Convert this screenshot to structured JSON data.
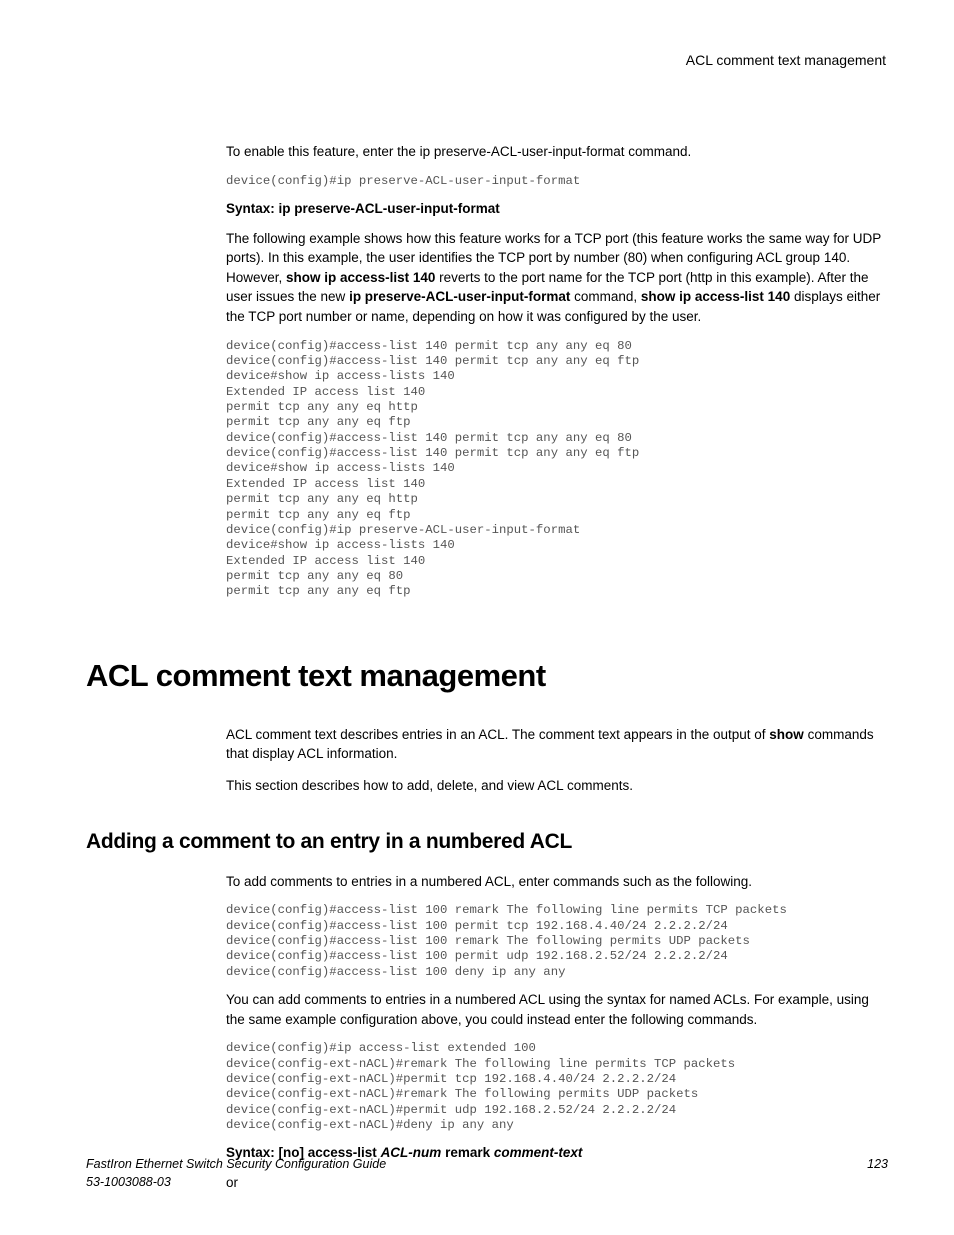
{
  "header": {
    "running": "ACL comment text management"
  },
  "body": {
    "intro": "To enable this feature, enter the ip preserve-ACL-user-input-format command.",
    "code1": "device(config)#ip preserve-ACL-user-input-format",
    "syntax1": "Syntax: ip preserve-ACL-user-input-format",
    "para1_a": "The following example shows how this feature works for a TCP port (this feature works the same way for UDP ports). In this example, the user identifies the TCP port by number (80) when configuring ACL group 140. However, ",
    "para1_b_bold": "show ip access-list 140",
    "para1_c": " reverts to the port name for the TCP port (http in this example). After the user issues the new ",
    "para1_d_bold": "ip preserve-ACL-user-input-format",
    "para1_e": " command, ",
    "para1_f_bold": "show ip access-list 140",
    "para1_g": " displays either the TCP port number or name, depending on how it was configured by the user.",
    "code2": "device(config)#access-list 140 permit tcp any any eq 80\ndevice(config)#access-list 140 permit tcp any any eq ftp\ndevice#show ip access-lists 140\nExtended IP access list 140\npermit tcp any any eq http\npermit tcp any any eq ftp\ndevice(config)#access-list 140 permit tcp any any eq 80\ndevice(config)#access-list 140 permit tcp any any eq ftp\ndevice#show ip access-lists 140\nExtended IP access list 140\npermit tcp any any eq http\npermit tcp any any eq ftp\ndevice(config)#ip preserve-ACL-user-input-format\ndevice#show ip access-lists 140\nExtended IP access list 140\npermit tcp any any eq 80\npermit tcp any any eq ftp",
    "h1": "ACL comment text management",
    "para2_a": "ACL comment text describes entries in an ACL. The comment text appears in the output of ",
    "para2_b_bold": "show",
    "para2_c": " commands that display ACL information.",
    "para3": "This section describes how to add, delete, and view ACL comments.",
    "h2": "Adding a comment to an entry in a numbered ACL",
    "para4": "To add comments to entries in a numbered ACL, enter commands such as the following.",
    "code3": "device(config)#access-list 100 remark The following line permits TCP packets\ndevice(config)#access-list 100 permit tcp 192.168.4.40/24 2.2.2.2/24\ndevice(config)#access-list 100 remark The following permits UDP packets\ndevice(config)#access-list 100 permit udp 192.168.2.52/24 2.2.2.2/24\ndevice(config)#access-list 100 deny ip any any",
    "para5": "You can add comments to entries in a numbered ACL using the syntax for named ACLs. For example, using the same example configuration above, you could instead enter the following commands.",
    "code4": "device(config)#ip access-list extended 100\ndevice(config-ext-nACL)#remark The following line permits TCP packets\ndevice(config-ext-nACL)#permit tcp 192.168.4.40/24 2.2.2.2/24\ndevice(config-ext-nACL)#remark The following permits UDP packets\ndevice(config-ext-nACL)#permit udp 192.168.2.52/24 2.2.2.2/24\ndevice(config-ext-nACL)#deny ip any any",
    "syntax2_a": "Syntax: [no] access-list ",
    "syntax2_b_it": "ACL-num",
    "syntax2_c": " remark ",
    "syntax2_d_it": "comment-text",
    "or": "or"
  },
  "footer": {
    "title": "FastIron Ethernet Switch Security Configuration Guide",
    "docnum": "53-1003088-03",
    "page": "123"
  }
}
